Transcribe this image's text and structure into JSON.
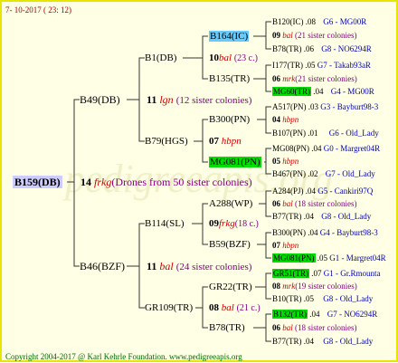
{
  "header_date": "7- 10-2017 ( 23: 12)",
  "footer": "Copyright 2004-2017 @ Karl Kehrle Foundation.   www.pedigreeapis.org",
  "watermark": "pedigreeapis.org",
  "root": {
    "name": "B159(DB)",
    "num": "14",
    "race": "frkg",
    "desc": "(Drones from 50 sister colonies)"
  },
  "gen1": [
    {
      "name": "B49(DB)",
      "num": "11",
      "race": "lgn",
      "desc": "(12 sister colonies)"
    },
    {
      "name": "B46(BZF)",
      "num": "11",
      "race": "bal",
      "desc": "(24 sister colonies)"
    }
  ],
  "gen2": [
    {
      "name": "B1(DB)",
      "num": "10",
      "race": "bal",
      "desc": "(23 c.)"
    },
    {
      "name": "B79(HGS)",
      "num": "07",
      "race": "hbpn",
      "desc": ""
    },
    {
      "name": "B114(SL)",
      "num": "09",
      "race": "frkg",
      "desc": "(18 c.)"
    },
    {
      "name": "GR109(TR)",
      "num": "08",
      "race": "bal",
      "desc": "(21 c.)"
    }
  ],
  "gen3": [
    {
      "name": "B164(IC)"
    },
    {
      "name": "B135(TR)"
    },
    {
      "name": "B300(PN)",
      "num": "04",
      "race": "hbpn"
    },
    {
      "name": "MG081(PN)"
    },
    {
      "name": "A288(WP)"
    },
    {
      "name": "B59(BZF)"
    },
    {
      "name": "GR22(TR)"
    },
    {
      "name": "B78(TR)"
    }
  ],
  "gen4": [
    {
      "name": "B120(IC)",
      "year": ".08",
      "code": "G6 - MG00R"
    },
    {
      "num": "09",
      "race": "bal",
      "desc": "(21 sister colonies)"
    },
    {
      "name": "B78(TR)",
      "year": ".06",
      "code": "G8 - NO6294R"
    },
    {
      "name": "I177(TR)",
      "year": ".05",
      "code": "G7 - Takab93aR"
    },
    {
      "num": "06",
      "race": "mrk",
      "desc": "(21 sister colonies)"
    },
    {
      "name": "MG60(TR)",
      "year": ".04",
      "code": "G4 - MG00R"
    },
    {
      "name": "A517(PN)",
      "year": ".03",
      "code": "G3 - Bayburt98-3"
    },
    {
      "num": "04",
      "race": "hbpn",
      "desc": ""
    },
    {
      "name": "B107(PN)",
      "year": ".01",
      "code": "G6 - Old_Lady"
    },
    {
      "name": "MG08(PN)",
      "year": ".04",
      "code": "G0 - Margret04R"
    },
    {
      "num": "05",
      "race": "hbpn",
      "desc": ""
    },
    {
      "name": "B467(PN)",
      "year": ".02",
      "code": "G7 - Old_Lady"
    },
    {
      "name": "A284(PJ)",
      "year": ".04",
      "code": "G5 - Cankiri97Q"
    },
    {
      "num": "06",
      "race": "bal",
      "desc": "(18 sister colonies)"
    },
    {
      "name": "B77(TR)",
      "year": ".04",
      "code": "G8 - Old_Lady"
    },
    {
      "name": "B300(PN)",
      "year": ".04",
      "code": "G4 - Bayburt98-3"
    },
    {
      "num": "07",
      "race": "hbpn",
      "desc": ""
    },
    {
      "name": "MG081(PN)",
      "year": ".05",
      "code": "G1 - Margret04R"
    },
    {
      "name": "GR51(TR)",
      "year": ".07",
      "code": "G1 - Gr.Rmounta"
    },
    {
      "num": "08",
      "race": "mrk",
      "desc": "(19 sister colonies)"
    },
    {
      "name": "B10(TR)",
      "year": ".05",
      "code": "G8 - Old_Lady"
    },
    {
      "name": "B132(TR)",
      "year": ".04",
      "code": "G7 - NO6294R"
    },
    {
      "num": "06",
      "race": "bal",
      "desc": "(18 sister colonies)"
    },
    {
      "name": "B77(TR)",
      "year": ".04",
      "code": "G8 - Old_Lady"
    }
  ],
  "colors": {
    "border": "#e6e600",
    "background": "#ffffe6",
    "root_highlight": "#ccccff",
    "cyan_highlight": "#66ccff",
    "green_highlight": "#00dd00",
    "race_red": "#cc0000",
    "desc_purple": "#800080",
    "code_blue": "#0000aa"
  }
}
